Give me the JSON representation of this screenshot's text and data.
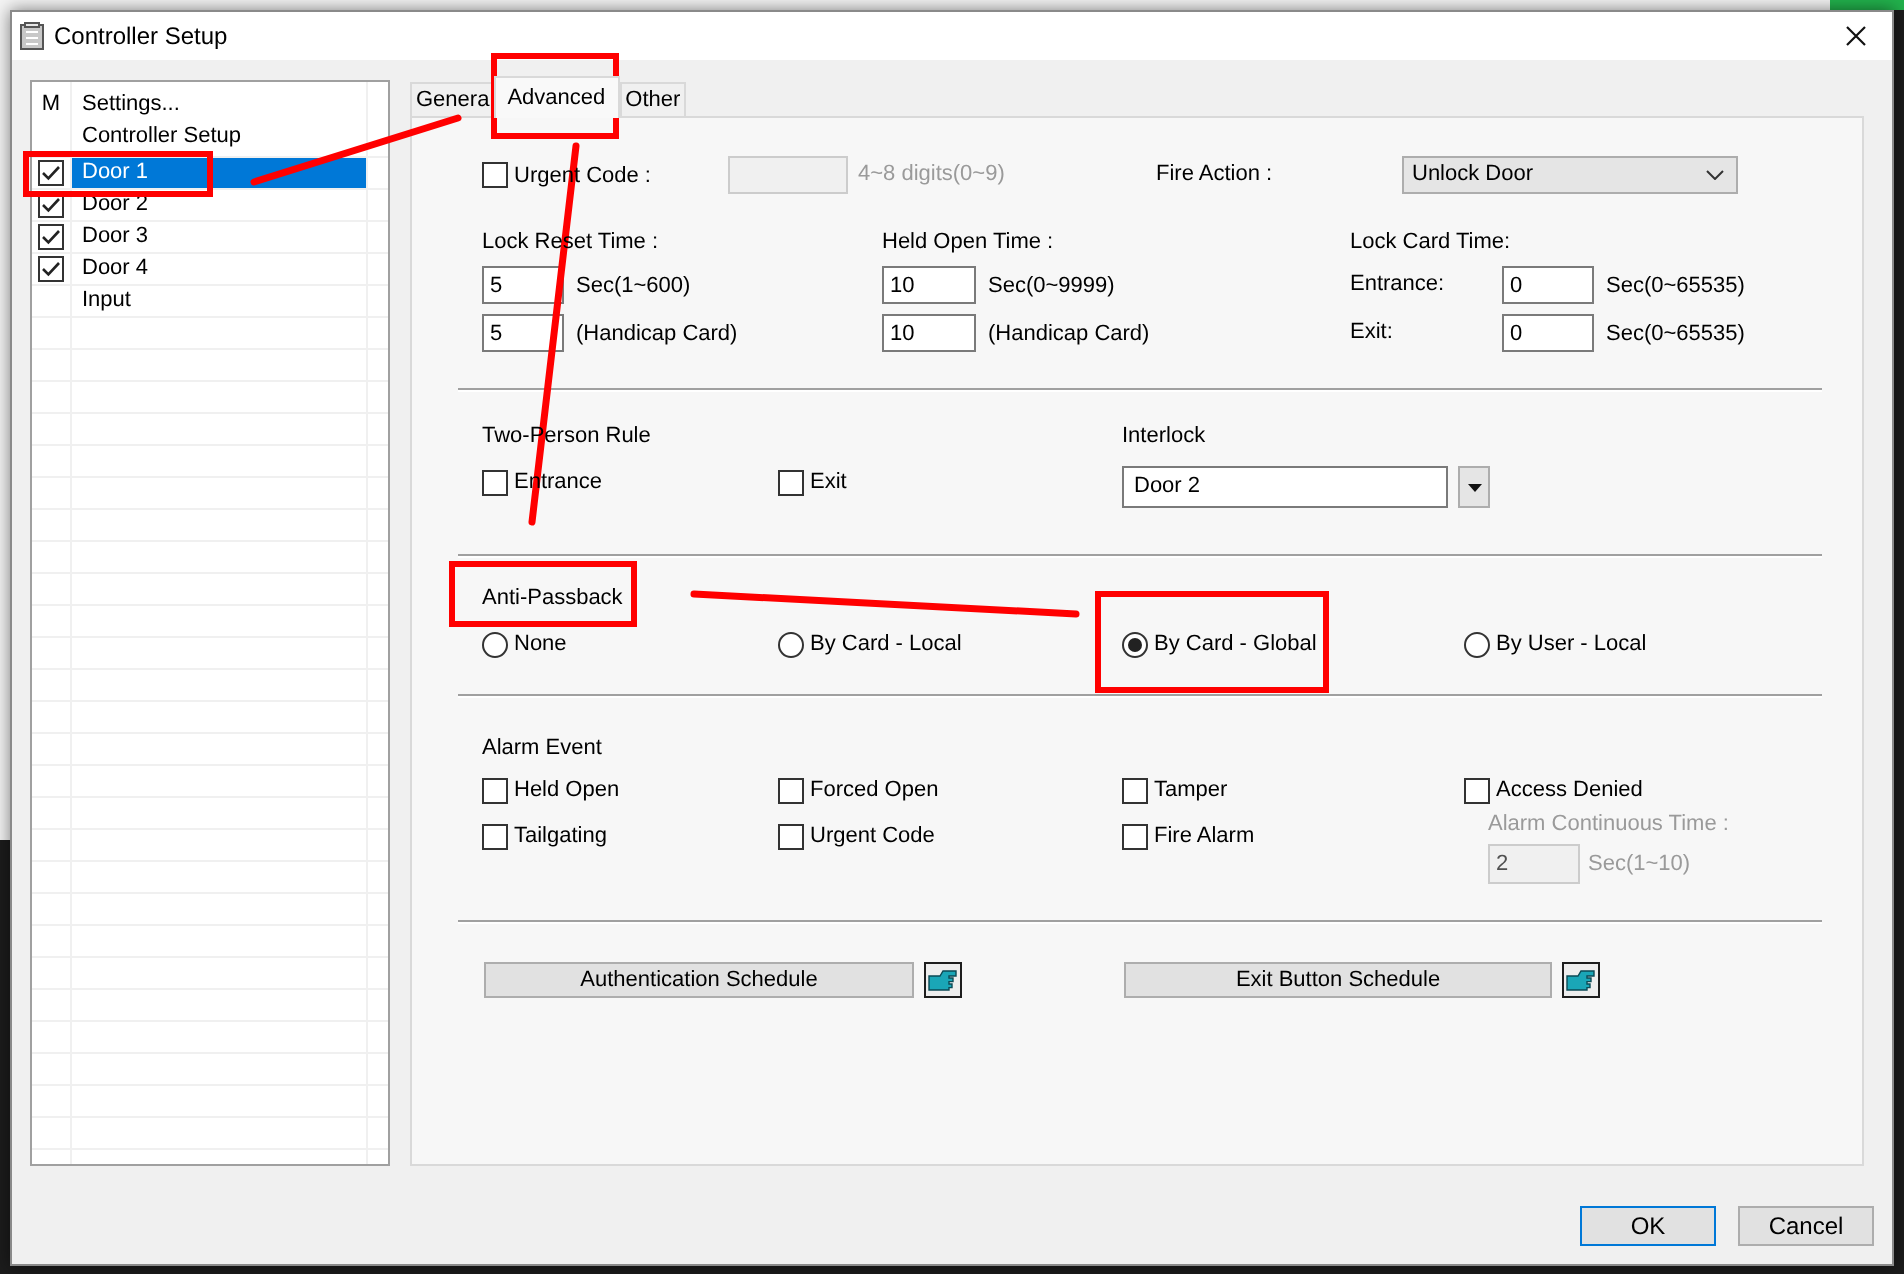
{
  "window": {
    "title": "Controller Setup"
  },
  "device_list": {
    "columns": [
      "M",
      "Settings..."
    ],
    "group": "Controller Setup",
    "items": [
      {
        "kind": "checkbox",
        "label": "Door 1",
        "checked": true,
        "selected": true
      },
      {
        "kind": "checkbox",
        "label": "Door 2",
        "checked": true,
        "selected": false
      },
      {
        "kind": "checkbox",
        "label": "Door 3",
        "checked": true,
        "selected": false
      },
      {
        "kind": "checkbox",
        "label": "Door 4",
        "checked": true,
        "selected": false
      },
      {
        "kind": "plain",
        "label": "Input",
        "selected": false
      }
    ]
  },
  "tabs": [
    {
      "label": "Genera",
      "selected": false
    },
    {
      "label": "Advanced",
      "selected": true
    },
    {
      "label": "Other",
      "selected": false
    }
  ],
  "urgent_code": {
    "label": "Urgent Code :",
    "checked": false,
    "disabled": true,
    "hint": "4~8 digits(0~9)"
  },
  "fire_action": {
    "label": "Fire Action :",
    "value": "Unlock Door"
  },
  "time_groups": [
    {
      "label": "Lock Reset Time :",
      "rows": [
        {
          "value": "5",
          "unit": "Sec(1~600)"
        },
        {
          "value": "5",
          "unit": "(Handicap Card)"
        }
      ]
    },
    {
      "label": "Held Open Time :",
      "rows": [
        {
          "value": "10",
          "unit": "Sec(0~9999)"
        },
        {
          "value": "10",
          "unit": "(Handicap Card)"
        }
      ]
    },
    {
      "label": "Lock Card Time:",
      "rows": [
        {
          "label": "Entrance:",
          "value": "0",
          "unit": "Sec(0~65535)"
        },
        {
          "label": "Exit:",
          "value": "0",
          "unit": "Sec(0~65535)"
        }
      ]
    }
  ],
  "two_person_rule": {
    "label": "Two-Person Rule",
    "options": [
      {
        "label": "Entrance",
        "checked": false
      },
      {
        "label": "Exit",
        "checked": false
      }
    ]
  },
  "interlock": {
    "label": "Interlock",
    "value": "Door 2"
  },
  "anti_passback": {
    "label": "Anti-Passback",
    "options": [
      {
        "label": "None",
        "selected": false
      },
      {
        "label": "By Card - Local",
        "selected": false
      },
      {
        "label": "By Card - Global",
        "selected": true
      },
      {
        "label": "By User - Local",
        "selected": false
      }
    ]
  },
  "alarm_event": {
    "label": "Alarm Event",
    "options": [
      {
        "label": "Held Open",
        "checked": false
      },
      {
        "label": "Forced Open",
        "checked": false
      },
      {
        "label": "Tamper",
        "checked": false
      },
      {
        "label": "Access Denied",
        "checked": false
      },
      {
        "label": "Tailgating",
        "checked": false
      },
      {
        "label": "Urgent Code",
        "checked": false
      },
      {
        "label": "Fire Alarm",
        "checked": false
      }
    ],
    "continuous_time": {
      "label": "Alarm Continuous Time :",
      "value": "2",
      "unit": "Sec(1~10)",
      "disabled": true
    }
  },
  "schedules": [
    {
      "label": "Authentication Schedule"
    },
    {
      "label": "Exit Button Schedule"
    }
  ],
  "buttons": [
    {
      "label": "OK",
      "default": true
    },
    {
      "label": "Cancel",
      "default": false
    }
  ]
}
